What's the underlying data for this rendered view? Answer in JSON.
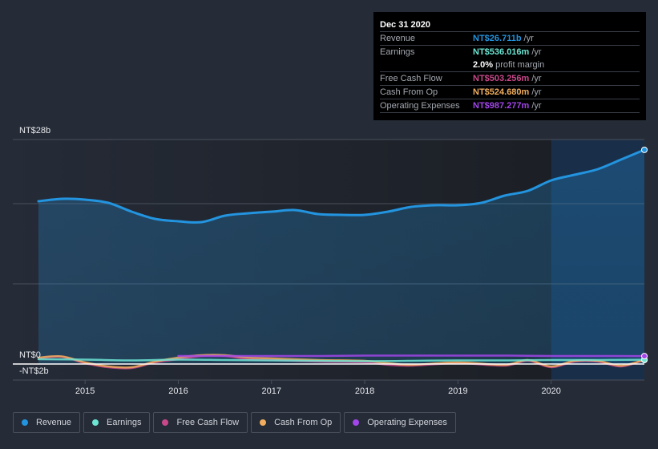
{
  "tooltip": {
    "date": "Dec 31 2020",
    "rows": [
      {
        "label": "Revenue",
        "value": "NT$26.711b",
        "unit": "/yr",
        "color": "#2394df"
      },
      {
        "label": "Earnings",
        "value": "NT$536.016m",
        "unit": "/yr",
        "color": "#6ce5d3"
      },
      {
        "label": "",
        "value": "2.0%",
        "unit": "profit margin",
        "color": "#ffffff"
      },
      {
        "label": "Free Cash Flow",
        "value": "NT$503.256m",
        "unit": "/yr",
        "color": "#c9488a"
      },
      {
        "label": "Cash From Op",
        "value": "NT$524.680m",
        "unit": "/yr",
        "color": "#f0ad5e"
      },
      {
        "label": "Operating Expenses",
        "value": "NT$987.277m",
        "unit": "/yr",
        "color": "#a245ea"
      }
    ]
  },
  "legend": [
    {
      "label": "Revenue",
      "color": "#2394df"
    },
    {
      "label": "Earnings",
      "color": "#6ce5d3"
    },
    {
      "label": "Free Cash Flow",
      "color": "#c9488a"
    },
    {
      "label": "Cash From Op",
      "color": "#f0ad5e"
    },
    {
      "label": "Operating Expenses",
      "color": "#a245ea"
    }
  ],
  "chart_data": {
    "type": "line",
    "title": "",
    "xlabel": "",
    "ylabel": "",
    "y_tick_labels": [
      "NT$28b",
      "NT$0",
      "-NT$2b"
    ],
    "y_ticks": [
      28,
      0,
      -2
    ],
    "ylim": [
      -2,
      28
    ],
    "xlim": [
      2014.5,
      2021.0
    ],
    "x_tick_labels": [
      "2015",
      "2016",
      "2017",
      "2018",
      "2019",
      "2020"
    ],
    "x_ticks": [
      2015,
      2016,
      2017,
      2018,
      2019,
      2020
    ],
    "grid": true,
    "forecast_shade_start": 2020.0,
    "legend_position": "bottom",
    "series": [
      {
        "name": "Revenue",
        "color": "#2394df",
        "fill": true,
        "x": [
          2014.5,
          2014.75,
          2015.0,
          2015.25,
          2015.5,
          2015.75,
          2016.0,
          2016.25,
          2016.5,
          2016.75,
          2017.0,
          2017.25,
          2017.5,
          2017.75,
          2018.0,
          2018.25,
          2018.5,
          2018.75,
          2019.0,
          2019.25,
          2019.5,
          2019.75,
          2020.0,
          2020.25,
          2020.5,
          2020.75,
          2021.0
        ],
        "values": [
          20.3,
          20.6,
          20.5,
          20.1,
          19.0,
          18.1,
          17.8,
          17.7,
          18.5,
          18.8,
          19.0,
          19.2,
          18.7,
          18.6,
          18.6,
          19.0,
          19.6,
          19.8,
          19.8,
          20.1,
          21.0,
          21.6,
          22.9,
          23.6,
          24.3,
          25.5,
          26.711
        ]
      },
      {
        "name": "Earnings",
        "color": "#6ce5d3",
        "fill": false,
        "x": [
          2014.5,
          2015.0,
          2015.5,
          2016.0,
          2016.5,
          2017.0,
          2017.5,
          2018.0,
          2018.5,
          2019.0,
          2019.5,
          2020.0,
          2020.5,
          2021.0
        ],
        "values": [
          0.6,
          0.55,
          0.45,
          0.55,
          0.5,
          0.45,
          0.4,
          0.35,
          0.4,
          0.45,
          0.45,
          0.5,
          0.5,
          0.536
        ]
      },
      {
        "name": "Free Cash Flow",
        "color": "#c9488a",
        "fill": false,
        "x": [
          2014.5,
          2014.75,
          2015.0,
          2015.25,
          2015.5,
          2015.75,
          2016.0,
          2016.25,
          2016.5,
          2016.75,
          2017.0,
          2017.5,
          2018.0,
          2018.25,
          2018.5,
          2019.0,
          2019.5,
          2019.75,
          2020.0,
          2020.25,
          2020.5,
          2020.75,
          2021.0
        ],
        "values": [
          0.7,
          0.9,
          0.1,
          -0.4,
          -0.5,
          0.2,
          0.6,
          1.0,
          1.0,
          0.6,
          0.5,
          0.3,
          0.2,
          -0.1,
          -0.2,
          0.1,
          -0.2,
          0.4,
          -0.4,
          0.3,
          0.3,
          -0.3,
          0.503
        ]
      },
      {
        "name": "Cash From Op",
        "color": "#f0ad5e",
        "fill": false,
        "x": [
          2014.5,
          2014.75,
          2015.0,
          2015.25,
          2015.5,
          2015.75,
          2016.0,
          2016.25,
          2016.5,
          2016.75,
          2017.0,
          2017.5,
          2018.0,
          2018.25,
          2018.5,
          2019.0,
          2019.5,
          2019.75,
          2020.0,
          2020.25,
          2020.5,
          2020.75,
          2021.0
        ],
        "values": [
          0.8,
          0.95,
          0.2,
          -0.3,
          -0.4,
          0.3,
          0.8,
          1.1,
          1.1,
          0.8,
          0.7,
          0.5,
          0.4,
          0.1,
          -0.1,
          0.2,
          -0.1,
          0.5,
          -0.3,
          0.4,
          0.4,
          -0.2,
          0.525
        ]
      },
      {
        "name": "Operating Expenses",
        "color": "#a245ea",
        "fill": false,
        "x": [
          2016.0,
          2016.5,
          2017.0,
          2017.5,
          2018.0,
          2018.5,
          2019.0,
          2019.5,
          2020.0,
          2020.5,
          2021.0
        ],
        "values": [
          1.0,
          1.0,
          1.0,
          1.0,
          1.05,
          1.05,
          1.05,
          1.05,
          1.0,
          1.0,
          0.987
        ]
      }
    ]
  }
}
